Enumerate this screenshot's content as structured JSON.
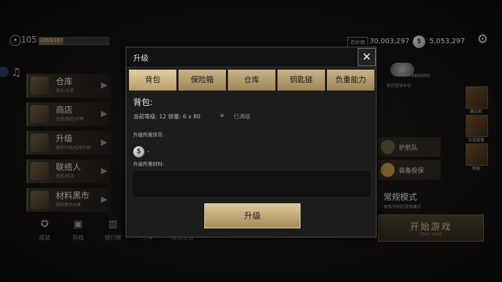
{
  "player": {
    "level": "105",
    "xp_text": "2260/167",
    "xp_fraction": 0.35
  },
  "currency": {
    "total_label": "总价值",
    "total_value": "30,003,297",
    "silver_value": "5,053,297"
  },
  "menu": [
    {
      "title": "仓库",
      "sub": "背包/仓库"
    },
    {
      "title": "商店",
      "sub": "武器/弹药/护甲"
    },
    {
      "title": "升级",
      "sub": "背包升级/仓库升级"
    },
    {
      "title": "联络人",
      "sub": "任务/商店"
    },
    {
      "title": "材料黑市",
      "sub": "稀缺素材出售"
    }
  ],
  "bottom_nav": [
    {
      "label": "成就"
    },
    {
      "label": "存档"
    },
    {
      "label": "排行榜"
    },
    {
      "label": "分享"
    },
    {
      "label": "建议反馈"
    }
  ],
  "right_panel": {
    "reward_count": "X60000",
    "reward_sub": "每日登录补给",
    "side_items": [
      "藏品柜",
      "合成装备",
      "图鉴"
    ],
    "escort": "护航队",
    "insurance": "装备投保",
    "mode_title": "常规模式",
    "mode_sub": "体验不同的游戏模式",
    "start_label": "开始游戏",
    "start_sub": "START GAME"
  },
  "modal": {
    "title": "升级",
    "close_symbol": "✕",
    "tabs": [
      "背包",
      "保险箱",
      "仓库",
      "钥匙链",
      "负重能力"
    ],
    "section_title": "背包:",
    "current_level_label": "当前等级:",
    "current_level": "12",
    "capacity_label": "容量:",
    "capacity": "6 x 80",
    "max_arrows": "»",
    "max_text": "已满级",
    "cost_label": "升级所需货币:",
    "cost_value": "-",
    "material_label": "升级所需材料:",
    "upgrade_label": "升级"
  }
}
